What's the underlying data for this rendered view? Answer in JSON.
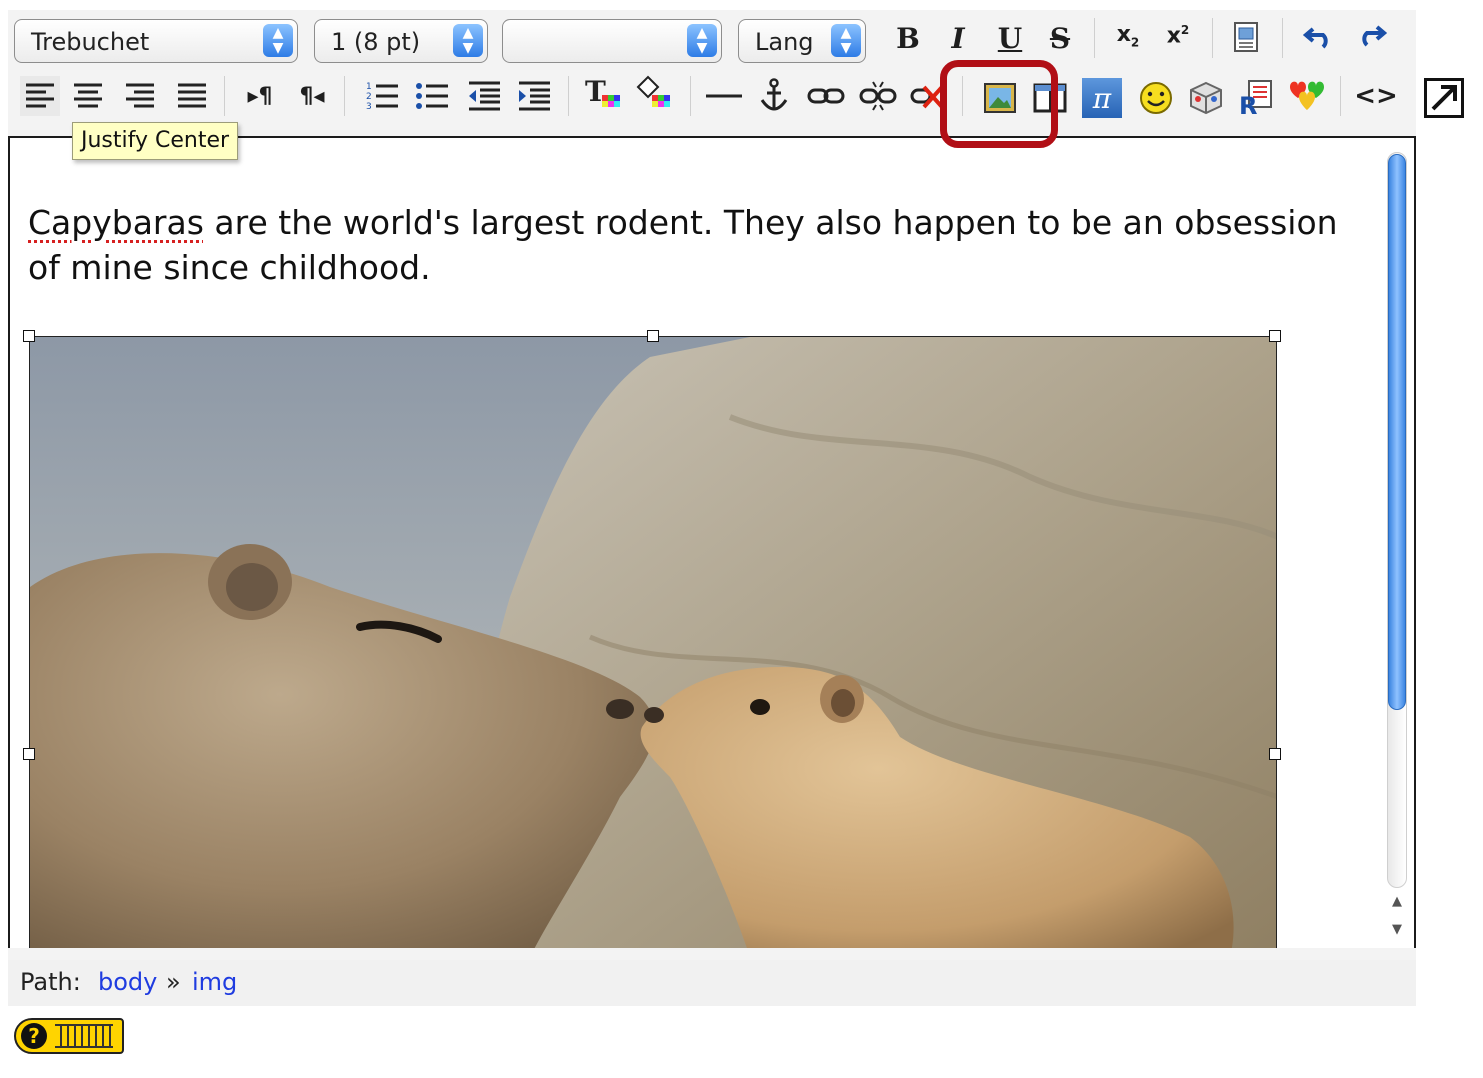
{
  "toolbar": {
    "font_family": "Trebuchet",
    "font_size": "1 (8 pt)",
    "heading": "",
    "lang": "Lang",
    "bold": "B",
    "italic": "I",
    "underline": "U",
    "strike": "S",
    "subscript": "x",
    "subscript_mark": "2",
    "superscript": "x",
    "superscript_mark": "2",
    "pi": "π",
    "source": "<>"
  },
  "tooltip": "Justify Center",
  "content": {
    "misspelled_word": "Capybaras",
    "paragraph_rest": " are the world's largest rodent.  They also happen to be an obsession of mine since childhood."
  },
  "path": {
    "label": "Path:",
    "items": [
      "body",
      "img"
    ],
    "separator": "»"
  },
  "help": {
    "label": "?"
  },
  "colors": {
    "highlight": "#b10f16",
    "link": "#1f3ce0",
    "tooltip_bg": "#ffffc4",
    "scroll_thumb": "#3b84e0"
  }
}
